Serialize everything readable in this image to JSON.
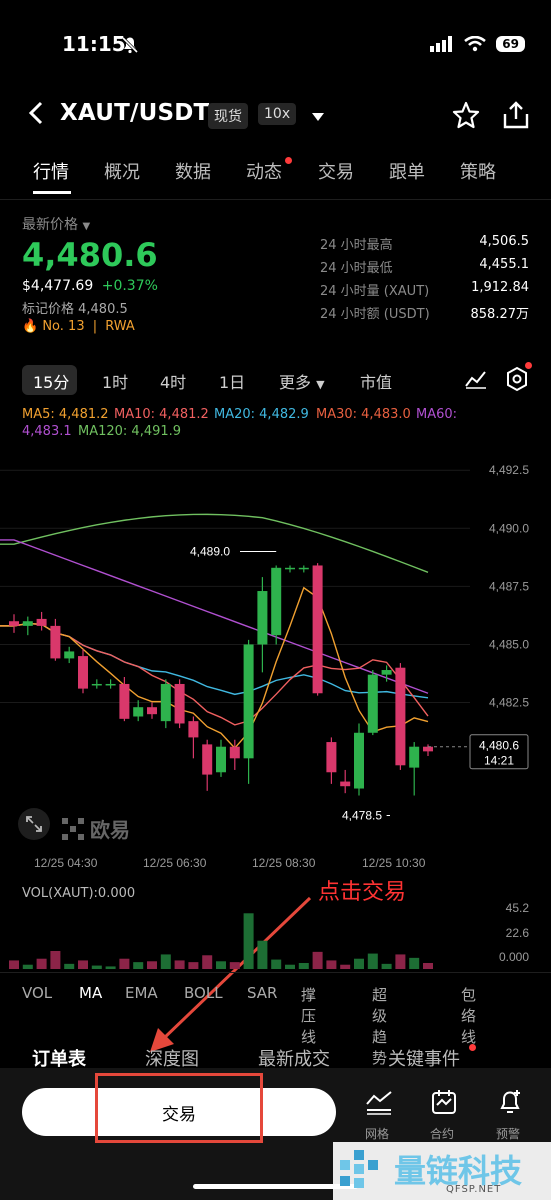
{
  "status_bar": {
    "time": "11:15",
    "battery": "69"
  },
  "header": {
    "pair": "XAUT/USDT",
    "tag_spot": "现货",
    "tag_leverage": "10x"
  },
  "tabs": [
    {
      "label": "行情",
      "active": true
    },
    {
      "label": "概况"
    },
    {
      "label": "数据"
    },
    {
      "label": "动态",
      "dot": true
    },
    {
      "label": "交易"
    },
    {
      "label": "跟单"
    },
    {
      "label": "策略"
    }
  ],
  "price": {
    "label": "最新价格",
    "value": "4,480.6",
    "usd": "$4,477.69",
    "change": "+0.37%",
    "mark": "标记价格 4,480.5",
    "rank": "No. 13",
    "sep": "|",
    "tag": "RWA"
  },
  "stats": [
    {
      "label": "24 小时最高",
      "value": "4,506.5"
    },
    {
      "label": "24 小时最低",
      "value": "4,455.1"
    },
    {
      "label": "24 小时量 (XAUT)",
      "value": "1,912.84"
    },
    {
      "label": "24 小时额 (USDT)",
      "value": "858.27万"
    }
  ],
  "intervals": [
    "15分",
    "1时",
    "4时",
    "1日",
    "更多",
    "市值"
  ],
  "ma_legend": {
    "ma5": "MA5: 4,481.2",
    "ma10": "MA10: 4,481.2",
    "ma20": "MA20: 4,482.9",
    "ma30": "MA30: 4,483.0",
    "ma60": "MA60:",
    "ma60_val": "4,483.1",
    "ma120": "MA120: 4,491.9"
  },
  "colors": {
    "up": "#2eb24d",
    "down": "#d9386b",
    "ma5": "#f0a030",
    "ma10": "#f06060",
    "ma20": "#40b8e0",
    "ma30": "#e86040",
    "ma60": "#b050d0",
    "ma120": "#70c060"
  },
  "chart_data": {
    "type": "candlestick",
    "y_ticks": [
      "4,492.5",
      "4,490.0",
      "4,487.5",
      "4,485.0",
      "4,482.5"
    ],
    "x_ticks": [
      "12/25 04:30",
      "12/25 06:30",
      "12/25 08:30",
      "12/25 10:30"
    ],
    "ylim": [
      4476.8,
      4493.8
    ],
    "high_label": "4,489.0",
    "low_label": "4,478.5",
    "last_price": "4,480.6",
    "countdown": "14:21",
    "candles": [
      {
        "o": 4486.0,
        "h": 4486.3,
        "l": 4485.5,
        "c": 4485.8
      },
      {
        "o": 4485.8,
        "h": 4486.2,
        "l": 4485.4,
        "c": 4486.0
      },
      {
        "o": 4486.1,
        "h": 4486.4,
        "l": 4485.6,
        "c": 4485.8
      },
      {
        "o": 4485.8,
        "h": 4486.1,
        "l": 4484.3,
        "c": 4484.4
      },
      {
        "o": 4484.4,
        "h": 4484.9,
        "l": 4484.2,
        "c": 4484.7
      },
      {
        "o": 4484.5,
        "h": 4484.8,
        "l": 4482.9,
        "c": 4483.1
      },
      {
        "o": 4483.3,
        "h": 4483.5,
        "l": 4483.1,
        "c": 4483.3
      },
      {
        "o": 4483.3,
        "h": 4483.5,
        "l": 4483.1,
        "c": 4483.3
      },
      {
        "o": 4483.3,
        "h": 4483.6,
        "l": 4481.7,
        "c": 4481.8
      },
      {
        "o": 4481.9,
        "h": 4482.6,
        "l": 4481.7,
        "c": 4482.3
      },
      {
        "o": 4482.3,
        "h": 4482.5,
        "l": 4481.8,
        "c": 4482.0
      },
      {
        "o": 4481.7,
        "h": 4483.5,
        "l": 4481.4,
        "c": 4483.3
      },
      {
        "o": 4483.3,
        "h": 4483.5,
        "l": 4481.4,
        "c": 4481.6
      },
      {
        "o": 4481.7,
        "h": 4481.9,
        "l": 4480.1,
        "c": 4481.0
      },
      {
        "o": 4480.7,
        "h": 4480.9,
        "l": 4478.7,
        "c": 4479.4
      },
      {
        "o": 4479.5,
        "h": 4480.9,
        "l": 4479.3,
        "c": 4480.6
      },
      {
        "o": 4480.6,
        "h": 4480.9,
        "l": 4479.6,
        "c": 4480.1
      },
      {
        "o": 4480.1,
        "h": 4485.2,
        "l": 4479.0,
        "c": 4485.0
      },
      {
        "o": 4485.0,
        "h": 4487.9,
        "l": 4483.8,
        "c": 4487.3
      },
      {
        "o": 4485.4,
        "h": 4488.4,
        "l": 4485.0,
        "c": 4488.3
      },
      {
        "o": 4488.3,
        "h": 4488.4,
        "l": 4488.1,
        "c": 4488.3
      },
      {
        "o": 4488.3,
        "h": 4488.4,
        "l": 4488.1,
        "c": 4488.3
      },
      {
        "o": 4488.4,
        "h": 4488.5,
        "l": 4482.8,
        "c": 4482.9
      },
      {
        "o": 4480.8,
        "h": 4481.0,
        "l": 4479.0,
        "c": 4479.5
      },
      {
        "o": 4479.1,
        "h": 4479.6,
        "l": 4478.6,
        "c": 4478.9
      },
      {
        "o": 4478.8,
        "h": 4481.6,
        "l": 4478.5,
        "c": 4481.2
      },
      {
        "o": 4481.2,
        "h": 4483.9,
        "l": 4481.1,
        "c": 4483.7
      },
      {
        "o": 4483.7,
        "h": 4484.1,
        "l": 4483.4,
        "c": 4483.9
      },
      {
        "o": 4484.0,
        "h": 4484.2,
        "l": 4479.6,
        "c": 4479.8
      },
      {
        "o": 4479.7,
        "h": 4480.8,
        "l": 4478.5,
        "c": 4480.6
      },
      {
        "o": 4480.6,
        "h": 4480.7,
        "l": 4480.2,
        "c": 4480.4
      }
    ],
    "volume_label": "VOL(XAUT):0.000",
    "vol_ticks": [
      "45.2",
      "22.6",
      "0.000"
    ],
    "volumes": [
      1,
      0.5,
      1.2,
      2.1,
      0.6,
      1.0,
      0.4,
      0.3,
      1.2,
      0.8,
      0.9,
      1.7,
      1.0,
      0.8,
      1.6,
      0.9,
      0.8,
      6.5,
      3.3,
      1.1,
      0.5,
      0.7,
      2.0,
      1.0,
      0.5,
      1.2,
      1.8,
      0.6,
      1.7,
      1.3,
      0.7
    ]
  },
  "indicators": [
    "VOL",
    "MA",
    "EMA",
    "BOLL",
    "SAR",
    "撑压线",
    "超级趋势",
    "包络线"
  ],
  "bottom_tabs": [
    {
      "label": "订单表",
      "active": true
    },
    {
      "label": "深度图"
    },
    {
      "label": "最新成交"
    },
    {
      "label": "关键事件",
      "dot": true
    }
  ],
  "trade_button": "交易",
  "bottom_icons": [
    {
      "label": "网格"
    },
    {
      "label": "合约"
    },
    {
      "label": "预警"
    }
  ],
  "annotation": "点击交易",
  "watermark_chart": "欧易",
  "watermark": {
    "text": "量链科技",
    "sub": "QFSP.NET"
  }
}
